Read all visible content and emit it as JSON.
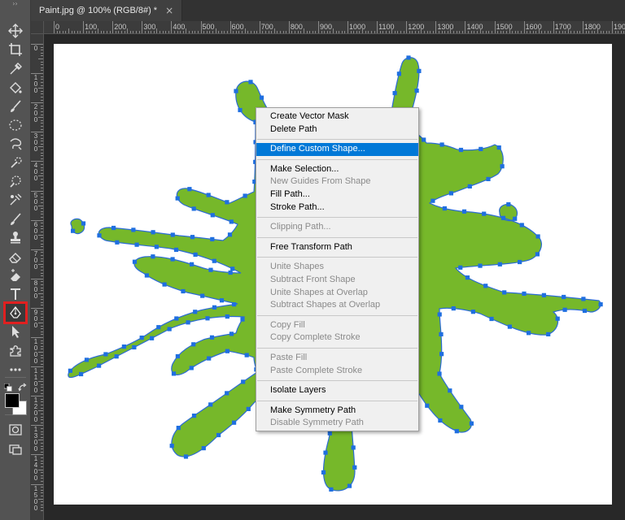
{
  "document_tab": {
    "title": "Paint.jpg @ 100% (RGB/8#) *",
    "close": "×"
  },
  "toolbar": {
    "grip": "››",
    "tools": [
      {
        "name": "move-tool",
        "icon": "move-icon"
      },
      {
        "name": "crop-tool",
        "icon": "crop-icon"
      },
      {
        "name": "eyedropper-tool",
        "icon": "eyedropper-icon"
      },
      {
        "name": "paint-bucket-tool",
        "icon": "paint-bucket-icon"
      },
      {
        "name": "brush-tool",
        "icon": "brush-icon"
      },
      {
        "name": "elliptical-marquee-tool",
        "icon": "ellipse-marquee-icon"
      },
      {
        "name": "lasso-tool",
        "icon": "lasso-icon"
      },
      {
        "name": "quick-selection-tool",
        "icon": "quick-selection-icon"
      },
      {
        "name": "healing-brush-tool",
        "icon": "healing-icon"
      },
      {
        "name": "color-replacement-tool",
        "icon": "color-replace-icon"
      },
      {
        "name": "brush-tool-2",
        "icon": "brush-icon"
      },
      {
        "name": "clone-stamp-tool",
        "icon": "stamp-icon"
      },
      {
        "name": "eraser-tool",
        "icon": "eraser-icon"
      },
      {
        "name": "background-eraser-tool",
        "icon": "bg-eraser-icon"
      },
      {
        "name": "type-tool",
        "icon": "type-icon"
      },
      {
        "name": "pen-tool",
        "icon": "pen-icon",
        "active": true
      },
      {
        "name": "path-selection-tool",
        "icon": "arrow-icon"
      },
      {
        "name": "custom-shape-tool",
        "icon": "puzzle-icon"
      },
      {
        "name": "more-tools",
        "icon": "ellipsis-icon"
      }
    ]
  },
  "rulers": {
    "horizontal": [
      "0",
      "100",
      "200",
      "300",
      "400",
      "500",
      "600",
      "700",
      "800",
      "900",
      "1000",
      "1100",
      "1200",
      "1300",
      "1400",
      "1500",
      "1600",
      "1700",
      "1800",
      "1900"
    ],
    "vertical": [
      "0",
      "100",
      "200",
      "300",
      "400",
      "500",
      "600",
      "700",
      "800",
      "900",
      "1000",
      "1100",
      "1200",
      "1300",
      "1400",
      "1500"
    ]
  },
  "context_menu": {
    "groups": [
      [
        {
          "label": "Create Vector Mask",
          "enabled": true
        },
        {
          "label": "Delete Path",
          "enabled": true
        }
      ],
      [
        {
          "label": "Define Custom Shape...",
          "enabled": true,
          "highlighted": true
        }
      ],
      [
        {
          "label": "Make Selection...",
          "enabled": true
        },
        {
          "label": "New Guides From Shape",
          "enabled": false
        },
        {
          "label": "Fill Path...",
          "enabled": true
        },
        {
          "label": "Stroke Path...",
          "enabled": true
        }
      ],
      [
        {
          "label": "Clipping Path...",
          "enabled": false
        }
      ],
      [
        {
          "label": "Free Transform Path",
          "enabled": true
        }
      ],
      [
        {
          "label": "Unite Shapes",
          "enabled": false
        },
        {
          "label": "Subtract Front Shape",
          "enabled": false
        },
        {
          "label": "Unite Shapes at Overlap",
          "enabled": false
        },
        {
          "label": "Subtract Shapes at Overlap",
          "enabled": false
        }
      ],
      [
        {
          "label": "Copy Fill",
          "enabled": false
        },
        {
          "label": "Copy Complete Stroke",
          "enabled": false
        }
      ],
      [
        {
          "label": "Paste Fill",
          "enabled": false
        },
        {
          "label": "Paste Complete Stroke",
          "enabled": false
        }
      ],
      [
        {
          "label": "Isolate Layers",
          "enabled": true
        }
      ],
      [
        {
          "label": "Make Symmetry Path",
          "enabled": true
        },
        {
          "label": "Disable Symmetry Path",
          "enabled": false
        }
      ]
    ]
  },
  "colors": {
    "foreground": "#000000",
    "background": "#ffffff",
    "splat_fill": "#76b82a",
    "path_stroke": "#2a6bd6",
    "anchor": "#1f6fe0",
    "highlight": "#0078d7",
    "tool_highlight_border": "#e02020"
  }
}
